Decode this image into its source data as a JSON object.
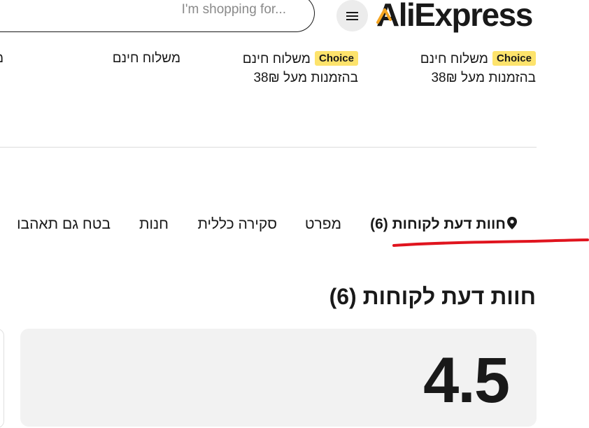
{
  "header": {
    "search_placeholder": "I'm shopping for...",
    "logo_text": "AliExpress",
    "menu_icon": "hamburger-menu-icon"
  },
  "shipping": {
    "items": [
      {
        "badge": "Choice",
        "line1": "משלוח חינם",
        "line2": "בהזמנות מעל 38₪"
      },
      {
        "badge": "Choice",
        "line1": "משלוח חינם",
        "line2": "בהזמנות מעל 38₪"
      },
      {
        "badge": "",
        "line1": "משלוח חינם",
        "line2": ""
      }
    ],
    "partial_cut": "מ"
  },
  "tabs": [
    {
      "label": "חוות דעת לקוחות (6)",
      "active": true,
      "icon": "location-pin-icon"
    },
    {
      "label": "מפרט",
      "active": false
    },
    {
      "label": "סקירה כללית",
      "active": false
    },
    {
      "label": "חנות",
      "active": false
    },
    {
      "label": "בטח גם תאהבו",
      "active": false
    }
  ],
  "reviews": {
    "title": "חוות דעת לקוחות (6)",
    "rating": "4.5"
  },
  "colors": {
    "choice_badge": "#fde36c",
    "annotation_red": "#e0141e",
    "logo_accent": "#f5a623"
  }
}
